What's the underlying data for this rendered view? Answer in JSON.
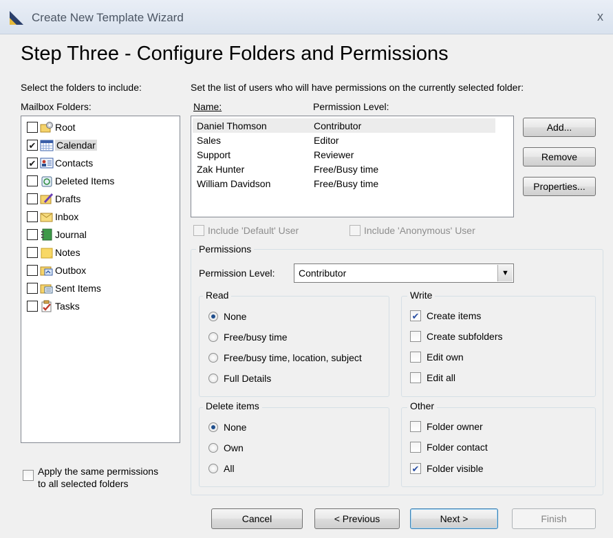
{
  "window": {
    "title": "Create New Template Wizard",
    "close_glyph": "x",
    "app_icon": "wizard-icon"
  },
  "step_title": "Step Three - Configure Folders and Permissions",
  "left": {
    "instruction": "Select the folders to include:",
    "list_label": "Mailbox Folders:",
    "folders": [
      {
        "label": "Root",
        "checked": false,
        "icon": "root-folder-icon"
      },
      {
        "label": "Calendar",
        "checked": true,
        "icon": "calendar-icon"
      },
      {
        "label": "Contacts",
        "checked": true,
        "icon": "contacts-icon"
      },
      {
        "label": "Deleted Items",
        "checked": false,
        "icon": "deleted-items-icon"
      },
      {
        "label": "Drafts",
        "checked": false,
        "icon": "drafts-icon"
      },
      {
        "label": "Inbox",
        "checked": false,
        "icon": "inbox-icon"
      },
      {
        "label": "Journal",
        "checked": false,
        "icon": "journal-icon"
      },
      {
        "label": "Notes",
        "checked": false,
        "icon": "notes-icon"
      },
      {
        "label": "Outbox",
        "checked": false,
        "icon": "outbox-icon"
      },
      {
        "label": "Sent Items",
        "checked": false,
        "icon": "sent-items-icon"
      },
      {
        "label": "Tasks",
        "checked": false,
        "icon": "tasks-icon"
      }
    ],
    "apply_same_line1": "Apply the same permissions",
    "apply_same_line2": "to all selected folders"
  },
  "right": {
    "instruction": "Set the list of users who will have permissions on the currently selected folder:",
    "col_name": "Name:",
    "col_level": "Permission Level:",
    "users": [
      {
        "name": "Daniel Thomson",
        "level": "Contributor"
      },
      {
        "name": "Sales",
        "level": "Editor"
      },
      {
        "name": "Support",
        "level": "Reviewer"
      },
      {
        "name": "Zak Hunter",
        "level": "Free/Busy time"
      },
      {
        "name": "William Davidson",
        "level": "Free/Busy time"
      }
    ],
    "add_button": "Add...",
    "remove_button": "Remove",
    "properties_button": "Properties...",
    "include_default": "Include 'Default' User",
    "include_anonymous": "Include 'Anonymous' User",
    "permissions_group": "Permissions",
    "permission_level_label": "Permission Level:",
    "permission_level_value": "Contributor",
    "read": {
      "title": "Read",
      "options": [
        "None",
        "Free/busy time",
        "Free/busy time, location, subject",
        "Full Details"
      ],
      "selected": "None"
    },
    "write": {
      "title": "Write",
      "options": [
        {
          "label": "Create items",
          "checked": true
        },
        {
          "label": "Create subfolders",
          "checked": false
        },
        {
          "label": "Edit own",
          "checked": false
        },
        {
          "label": "Edit all",
          "checked": false
        }
      ]
    },
    "delete": {
      "title": "Delete items",
      "options": [
        "None",
        "Own",
        "All"
      ],
      "selected": "None"
    },
    "other": {
      "title": "Other",
      "options": [
        {
          "label": "Folder owner",
          "checked": false
        },
        {
          "label": "Folder contact",
          "checked": false
        },
        {
          "label": "Folder visible",
          "checked": true
        }
      ]
    }
  },
  "footer": {
    "cancel": "Cancel",
    "previous": "< Previous",
    "next": "Next >",
    "finish": "Finish"
  },
  "colors": {
    "accent": "#1f4e8c",
    "selection": "#dcdcdc"
  }
}
